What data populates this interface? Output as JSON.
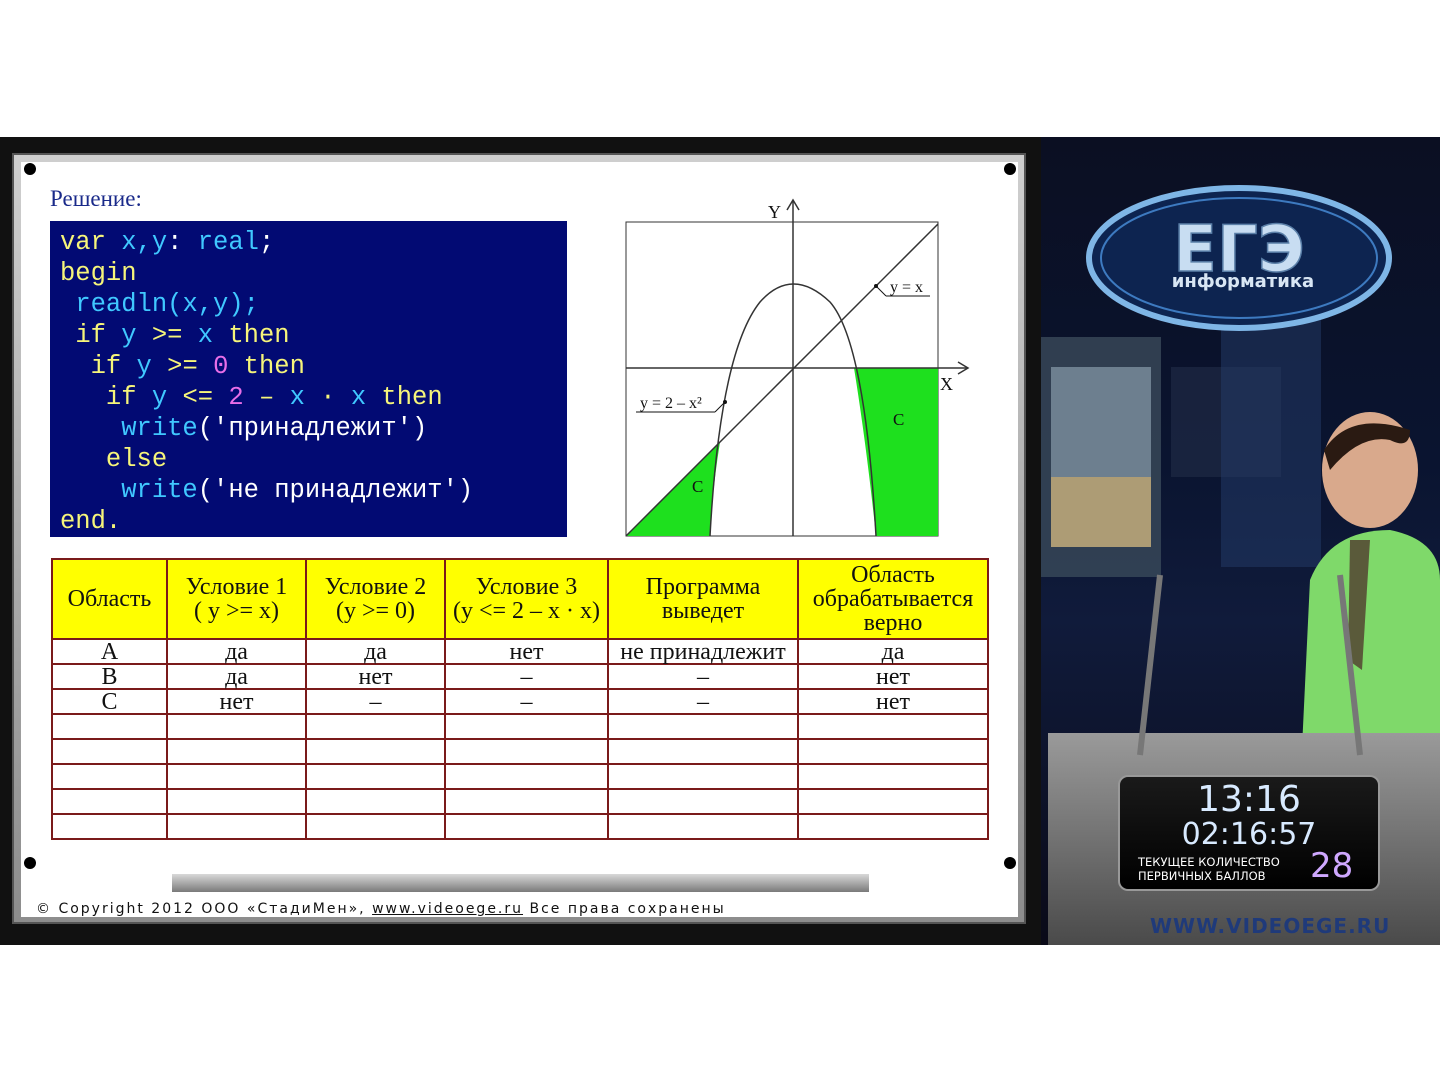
{
  "board": {
    "heading": "Решение:",
    "code_lines": [
      [
        {
          "t": "var ",
          "c": "kw"
        },
        {
          "t": "x,y",
          "c": "id"
        },
        {
          "t": ": ",
          "c": "op"
        },
        {
          "t": "real",
          "c": "id"
        },
        {
          "t": ";",
          "c": "op"
        }
      ],
      [
        {
          "t": "begin",
          "c": "kw"
        }
      ],
      [
        {
          "t": " ",
          "c": "op"
        },
        {
          "t": "readln",
          "c": "id"
        },
        {
          "t": "(x,y);",
          "c": "id"
        }
      ],
      [
        {
          "t": " ",
          "c": "op"
        },
        {
          "t": "if ",
          "c": "kw"
        },
        {
          "t": "y ",
          "c": "id"
        },
        {
          "t": ">= ",
          "c": "kw"
        },
        {
          "t": "x ",
          "c": "id"
        },
        {
          "t": "then",
          "c": "kw"
        }
      ],
      [
        {
          "t": "  ",
          "c": "op"
        },
        {
          "t": "if ",
          "c": "kw"
        },
        {
          "t": "y ",
          "c": "id"
        },
        {
          "t": ">= ",
          "c": "kw"
        },
        {
          "t": "0 ",
          "c": "num"
        },
        {
          "t": "then",
          "c": "kw"
        }
      ],
      [
        {
          "t": "   ",
          "c": "op"
        },
        {
          "t": "if ",
          "c": "kw"
        },
        {
          "t": "y ",
          "c": "id"
        },
        {
          "t": "<= ",
          "c": "kw"
        },
        {
          "t": "2 ",
          "c": "num"
        },
        {
          "t": "– ",
          "c": "kw"
        },
        {
          "t": "x ",
          "c": "id"
        },
        {
          "t": "· ",
          "c": "kw"
        },
        {
          "t": "x ",
          "c": "id"
        },
        {
          "t": "then",
          "c": "kw"
        }
      ],
      [
        {
          "t": "    ",
          "c": "op"
        },
        {
          "t": "write",
          "c": "id"
        },
        {
          "t": "('принадлежит')",
          "c": "str"
        }
      ],
      [
        {
          "t": "   ",
          "c": "op"
        },
        {
          "t": "else",
          "c": "kw"
        }
      ],
      [
        {
          "t": "    ",
          "c": "op"
        },
        {
          "t": "write",
          "c": "id"
        },
        {
          "t": "('не принадлежит')",
          "c": "str"
        }
      ],
      [
        {
          "t": "end.",
          "c": "kw"
        }
      ]
    ],
    "graph": {
      "axis_y": "Y",
      "axis_x": "X",
      "label_line": "y = x",
      "label_parabola": "y = 2 – x²",
      "region_left": "C",
      "region_right": "C",
      "fill_color": "#1ee01e"
    },
    "table": {
      "headers": [
        "Область",
        "Условие 1\n( y >= x)",
        "Условие 2\n(y >= 0)",
        "Условие 3\n(y <= 2 – x · x)",
        "Программа\nвыведет",
        "Область\nобрабатывается\nверно"
      ],
      "rows": [
        [
          "A",
          "да",
          "да",
          "нет",
          "не принадлежит",
          "да"
        ],
        [
          "B",
          "да",
          "нет",
          "–",
          "–",
          "нет"
        ],
        [
          "C",
          "нет",
          "–",
          "–",
          "–",
          "нет"
        ],
        [
          "",
          "",
          "",
          "",
          "",
          ""
        ],
        [
          "",
          "",
          "",
          "",
          "",
          ""
        ],
        [
          "",
          "",
          "",
          "",
          "",
          ""
        ],
        [
          "",
          "",
          "",
          "",
          "",
          ""
        ],
        [
          "",
          "",
          "",
          "",
          "",
          ""
        ]
      ],
      "header_color": "#ffff00",
      "border_color": "#7a1a1a"
    },
    "copyright": {
      "prefix": "©  Copyright 2012 ООО «СтадиМен», ",
      "site": "www.videoege.ru",
      "suffix": "   Все права сохранены"
    }
  },
  "studio": {
    "logo_main": "ЕГЭ",
    "logo_sub": "информатика",
    "clock_time": "13:16",
    "clock_timer": "02:16:57",
    "score_label_1": "ТЕКУЩЕЕ КОЛИЧЕСТВО",
    "score_label_2": "ПЕРВИЧНЫХ  БАЛЛОВ",
    "score_value": "28",
    "site": "WWW.VIDEOEGE.RU"
  }
}
